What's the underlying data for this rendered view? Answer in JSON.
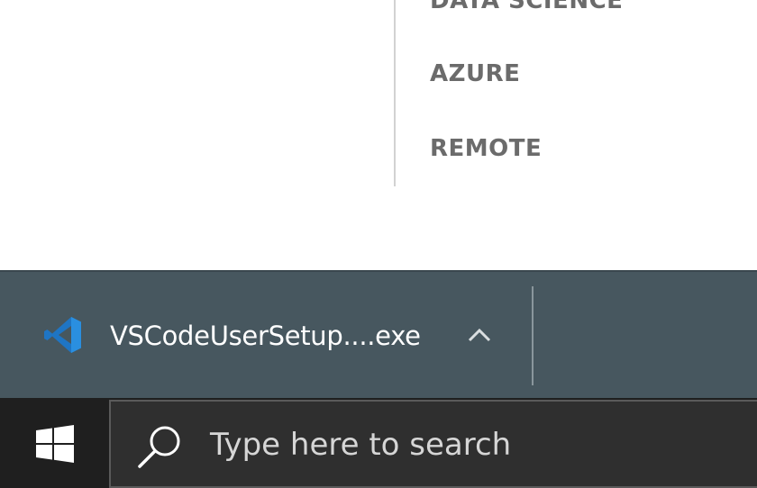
{
  "web_nav": {
    "items": [
      {
        "label": "DATA SCIENCE"
      },
      {
        "label": "AZURE"
      },
      {
        "label": "REMOTE"
      }
    ]
  },
  "download_bar": {
    "file_name": "VSCodeUserSetup....exe",
    "file_icon": "vscode-icon",
    "menu_icon": "chevron-up-icon"
  },
  "taskbar": {
    "start_icon": "windows-icon",
    "search": {
      "icon": "search-icon",
      "placeholder": "Type here to search"
    }
  },
  "colors": {
    "nav_text": "#6b6b6b",
    "download_bar_bg": "#47575f",
    "taskbar_bg": "#1f1f1f",
    "search_bg": "#2f2f2f",
    "vscode_blue": "#2a8fe0"
  }
}
